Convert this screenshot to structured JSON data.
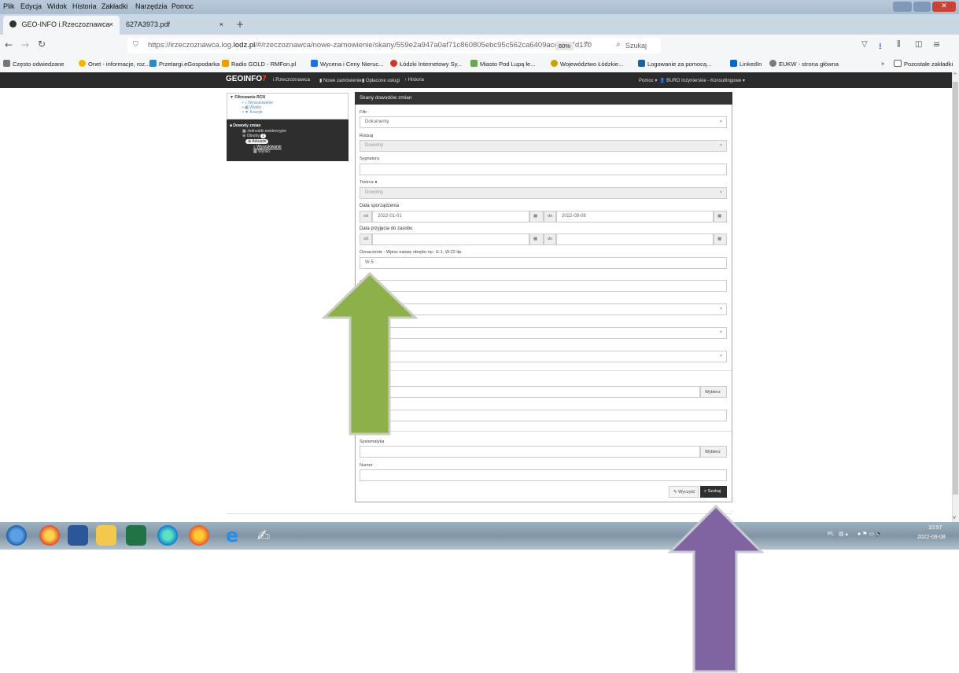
{
  "menu": [
    "Plik",
    "Edycja",
    "Widok",
    "Historia",
    "Zakładki",
    "Narzędzia",
    "Pomoc"
  ],
  "tabs": [
    {
      "label": "GEO-INFO i.Rzeczoznawca",
      "close": "×"
    },
    {
      "label": "627A3973.pdf",
      "close": "×"
    }
  ],
  "new_tab": "+",
  "nav": {
    "url_prefix": "https://irzeczoznawca.log.",
    "url_domain": "lodz.pl",
    "url_rest": "/#/rzeczoznawca/nowe-zamowienie/skany/559e2a947a0af71c860805ebc95c562ca6409ace5987d170",
    "zoom": "60%",
    "search_placeholder": "Szukaj"
  },
  "bookmarks": [
    {
      "label": "Często odwiedzane",
      "color": "#777777"
    },
    {
      "label": "Onet - informacje, roz...",
      "color": "#f5b400"
    },
    {
      "label": "Przetargi.eGospodarka",
      "color": "#2e8bc0"
    },
    {
      "label": "Radio GOLD - RMFon.pl",
      "color": "#e8a000"
    },
    {
      "label": "Wycena i Ceny Nieruc...",
      "color": "#1a73e8"
    },
    {
      "label": "Łódzki Internetowy Sy...",
      "color": "#d0342c"
    },
    {
      "label": "Miasto Pod Lupą łe...",
      "color": "#6aa84f"
    },
    {
      "label": "Województwo Łódzkie...",
      "color": "#caa300"
    },
    {
      "label": "Logowanie za pomocą...",
      "color": "#1f5fa8"
    },
    {
      "label": "LinkedIn",
      "color": "#0a66c2"
    },
    {
      "label": "EUKW - strona główna",
      "color": "#7a7a7a"
    }
  ],
  "other_bookmarks": "Pozostałe zakładki",
  "app": {
    "logo_main": "GEOINFO",
    "logo_num": "7",
    "logo_sub": "i.Rzeczoznawca",
    "nav": [
      "Nowe zamówienie",
      "Opłacone usługi",
      "Historia"
    ],
    "help": "Pomoc",
    "user": "BURO Inżynierskie - Konsultingowe"
  },
  "tree": {
    "filter_title": "Filtrowanie RCN",
    "filter_items": [
      "Wyszukiwanie",
      "Wyniki",
      "Koszyk"
    ],
    "docs_title": "Dowody zmian",
    "docs_items": [
      "Jednostki ewidencyjne",
      "Obręby",
      "Arkusze",
      "Wyszukiwanie",
      "Wyniki"
    ],
    "badge": "1"
  },
  "form": {
    "title": "Skany dowodów zmian",
    "fields": [
      {
        "label": "Filtr",
        "value": "Dokumenty"
      },
      {
        "label": "Rodzaj",
        "value": "Dowolny"
      },
      {
        "label": "Sygnatura",
        "value": ""
      },
      {
        "label": "Twórca",
        "value": "Dowolny"
      }
    ],
    "date_creation": {
      "label": "Data sporządzenia",
      "from_lbl": "od",
      "from": "2022-01-01",
      "to_lbl": "do",
      "to": "2022-09-08"
    },
    "date_accept": {
      "label": "Data przyjęcia do zasobu",
      "from_lbl": "od",
      "to_lbl": "do"
    },
    "designation": {
      "label": "Oznaczenie - Wpisz nazwę obrębu np.: E-1, W-22 itp.",
      "value": "W-5"
    },
    "system_label": "Systematyka",
    "number_label": "Numer",
    "choose": "Wybierz",
    "clear": "Wyczyść",
    "search": "Szukaj"
  },
  "taskbar": {
    "lang": "PL",
    "time": "10:57",
    "date": "2022-09-08"
  },
  "colors": {
    "green_arrow": "#8db04a",
    "purple_arrow": "#8064a2"
  }
}
